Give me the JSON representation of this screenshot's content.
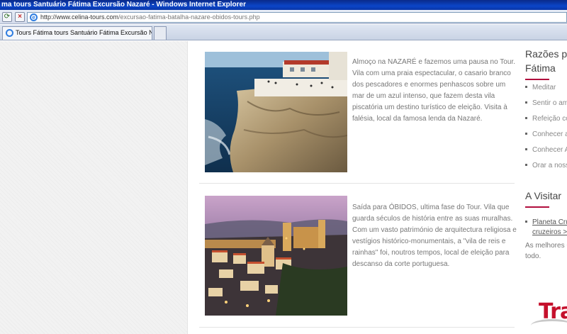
{
  "window": {
    "title": "ma tours Santuário Fátima Excursão Nazaré - Windows Internet Explorer"
  },
  "address": {
    "url_host": "http://www.celina-tours.com",
    "url_path": "/excursao-fatima-batalha-nazare-obidos-tours.php"
  },
  "tabs": [
    {
      "label": "Tours Fátima tours Santuário Fátima Excursão Nazaré"
    }
  ],
  "entries": [
    {
      "text": "Almoço na NAZARÉ e fazemos uma pausa no Tour. Vila com uma praia espectacular, o casario branco dos pescadores e enormes penhascos sobre um mar de um azul intenso, que fazem desta vila piscatória um destino turístico de eleição. Visita à falésia, local da famosa lenda da Nazaré."
    },
    {
      "text": "Saída para ÓBIDOS, ultima fase do Tour. Vila que guarda séculos de história entre as suas muralhas. Com um vasto património de arquitectura religiosa e vestígios histórico-monumentais, a \"vila de reis e rainhas\" foi, noutros tempos, local de eleição para descanso da corte portuguesa."
    }
  ],
  "sidebar": {
    "title_line1": "Razões pa",
    "title_line2": "Fátima",
    "items": [
      {
        "label": "Meditar"
      },
      {
        "label": "Sentir o amb"
      },
      {
        "label": "Refeição co"
      },
      {
        "label": "Conhecer a"
      },
      {
        "label": "Conhecer Al"
      },
      {
        "label": "Orar a noss"
      }
    ],
    "visit_title": "A Visitar",
    "visit_link_line1": "Planeta Cru",
    "visit_link_line2": "cruzeiros >",
    "visit_text_line1": "As melhores C",
    "visit_text_line2": "todo.",
    "logo_text": "Tra"
  },
  "colors": {
    "accent": "#b10e3d",
    "titlebar": "#0b45c8"
  }
}
